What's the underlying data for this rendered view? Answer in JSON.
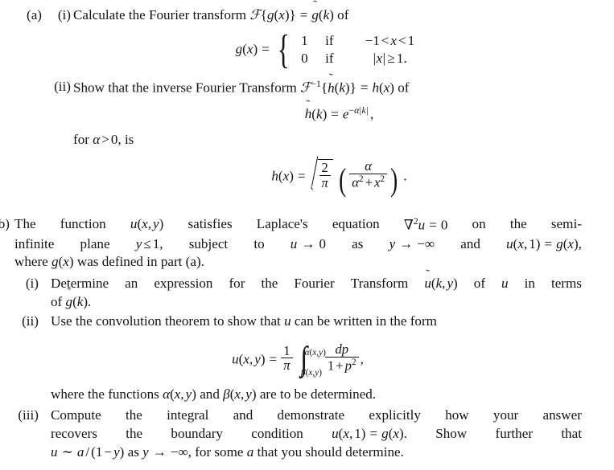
{
  "document": {
    "type": "mathematics-exam-question",
    "background_color": "#ffffff",
    "text_color": "#141414"
  },
  "part_a": {
    "label": "(a)",
    "sub_i": {
      "label": "(i)",
      "text_before_math": "Calculate the Fourier transform",
      "transform_expr": "F{g(x)} = g̃(k)",
      "text_after_math": "of",
      "line": "Calculate the Fourier transform F{g(x)} = g̃(k) of",
      "equation": {
        "lhs": "g(x) =",
        "case_1_value": "1",
        "case_1_if": "if",
        "case_1_condition": "−1 < x < 1",
        "case_2_value": "0",
        "case_2_if": "if",
        "case_2_condition": "|x| ≥ 1."
      }
    },
    "sub_ii": {
      "label": "(ii)",
      "line": "Show that the inverse Fourier Transform F⁻¹{h̃(k)} = h(x) of",
      "equation_htilde": "h̃(k) = e^{−α|k|} ,",
      "condition_line": "for α > 0, is",
      "equation_h": "h(x) = √(2/π) ( α / (α² + x²) ) ."
    }
  },
  "part_b": {
    "label": "b)",
    "label_clipped": true,
    "intro_lines": [
      "The function u(x, y) satisfies Laplace's equation ∇²u = 0 on the semi-",
      "infinite plane y ≤ 1, subject to u → 0 as y → −∞ and u(x, 1) = g(x),",
      "where g(x) was defined in part (a)."
    ],
    "sub_i": {
      "label": "(i)",
      "lines": [
        "Determine an expression for the Fourier Transform ũ(k, y) of u in terms",
        "of g̃(k)."
      ]
    },
    "sub_ii": {
      "label": "(ii)",
      "lines": [
        "Use the convolution theorem to show that u can be written in the form"
      ],
      "equation": {
        "lhs": "u(x, y) =",
        "prefactor_num": "1",
        "prefactor_den": "π",
        "integral_upper": "α(x,y)",
        "integral_lower": "β(x,y)",
        "integrand_num": "dp",
        "integrand_den": "1 + p²",
        "trailing": ","
      },
      "closing_line": "where the functions α(x, y) and β(x, y) are to be determined."
    },
    "sub_iii": {
      "label": "(iii)",
      "lines": [
        "Compute the integral and demonstrate explicitly how your answer",
        "recovers the boundary condition u(x, 1) = g(x).  Show further that",
        "u ∼ a/(1 − y) as y → −∞, for some a that you should determine."
      ]
    }
  },
  "symbols": {
    "script_F": "ℱ",
    "tilde": "˜",
    "nabla": "∇",
    "alpha": "α",
    "beta": "β",
    "pi": "π",
    "infinity": "∞",
    "rightarrow": "→",
    "leq": "≤",
    "geq": "≥",
    "sim": "∼",
    "minus": "−",
    "integral": "∫"
  }
}
